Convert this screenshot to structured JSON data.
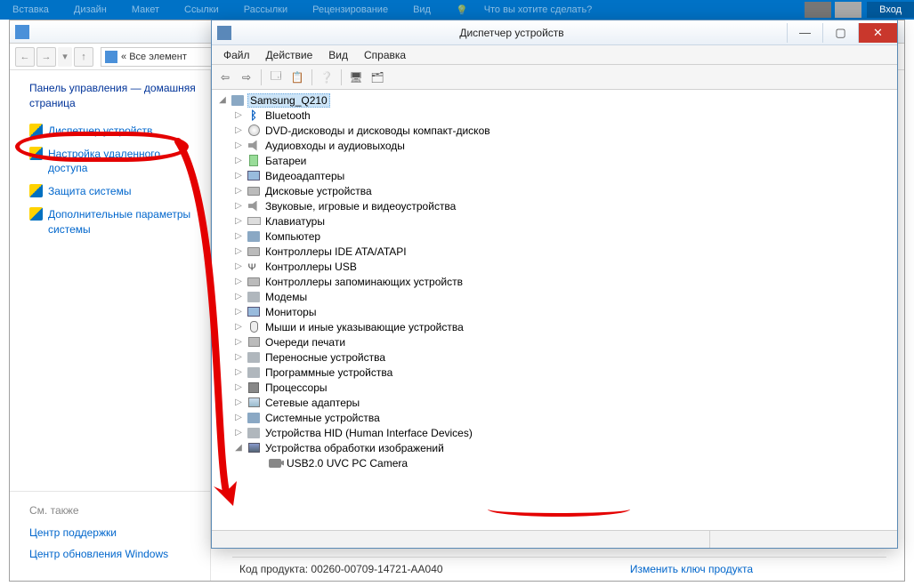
{
  "ribbon": {
    "tabs": [
      "Вставка",
      "Дизайн",
      "Макет",
      "Ссылки",
      "Рассылки",
      "Рецензирование",
      "Вид"
    ],
    "search_hint": "Что вы хотите сделать?",
    "login": "Вход"
  },
  "control_panel": {
    "breadcrumb_prefix": "«",
    "breadcrumb": "Все элемент",
    "sidebar_heading": "Панель управления — домашняя страница",
    "links": [
      "Диспетчер устройств",
      "Настройка удаленного доступа",
      "Защита системы",
      "Дополнительные параметры системы"
    ],
    "also_heading": "См. также",
    "also_links": [
      "Центр поддержки",
      "Центр обновления Windows"
    ],
    "footer_label": "Код продукта:",
    "footer_value": "00260-00709-14721-AA040",
    "footer_link": "Изменить ключ продукта"
  },
  "device_manager": {
    "title": "Диспетчер устройств",
    "menu": [
      "Файл",
      "Действие",
      "Вид",
      "Справка"
    ],
    "toolbar_icons": [
      "back",
      "fwd",
      "up",
      "props",
      "help",
      "scan",
      "show"
    ],
    "root": "Samsung_Q210",
    "categories": [
      {
        "label": "Bluetooth",
        "icon": "bt"
      },
      {
        "label": "DVD-дисководы и дисководы компакт-дисков",
        "icon": "disc"
      },
      {
        "label": "Аудиовходы и аудиовыходы",
        "icon": "audio"
      },
      {
        "label": "Батареи",
        "icon": "batt"
      },
      {
        "label": "Видеоадаптеры",
        "icon": "mon"
      },
      {
        "label": "Дисковые устройства",
        "icon": "hdd"
      },
      {
        "label": "Звуковые, игровые и видеоустройства",
        "icon": "audio"
      },
      {
        "label": "Клавиатуры",
        "icon": "kb"
      },
      {
        "label": "Компьютер",
        "icon": "pc"
      },
      {
        "label": "Контроллеры IDE ATA/ATAPI",
        "icon": "hdd"
      },
      {
        "label": "Контроллеры USB",
        "icon": "usb"
      },
      {
        "label": "Контроллеры запоминающих устройств",
        "icon": "hdd"
      },
      {
        "label": "Модемы",
        "icon": "generic"
      },
      {
        "label": "Мониторы",
        "icon": "mon"
      },
      {
        "label": "Мыши и иные указывающие устройства",
        "icon": "mouse"
      },
      {
        "label": "Очереди печати",
        "icon": "print"
      },
      {
        "label": "Переносные устройства",
        "icon": "generic"
      },
      {
        "label": "Программные устройства",
        "icon": "generic"
      },
      {
        "label": "Процессоры",
        "icon": "cpu"
      },
      {
        "label": "Сетевые адаптеры",
        "icon": "net"
      },
      {
        "label": "Системные устройства",
        "icon": "pc"
      },
      {
        "label": "Устройства HID (Human Interface Devices)",
        "icon": "generic"
      },
      {
        "label": "Устройства обработки изображений",
        "icon": "img",
        "expanded": true,
        "children": [
          {
            "label": "USB2.0 UVC PC Camera",
            "icon": "cam"
          }
        ]
      }
    ]
  }
}
